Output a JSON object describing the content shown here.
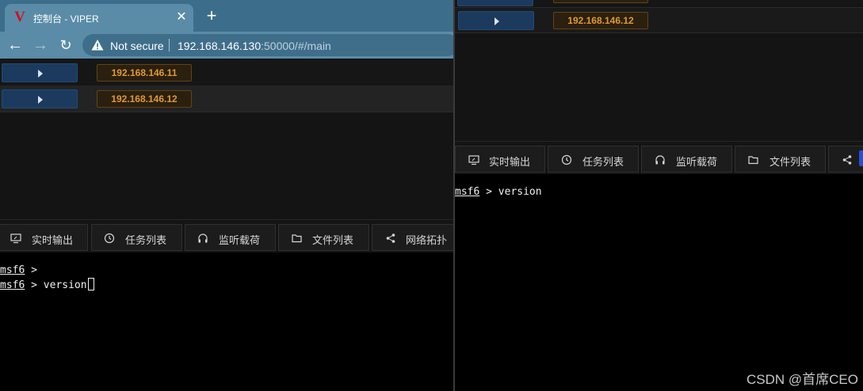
{
  "browser": {
    "tab": {
      "title": "控制台 - VIPER",
      "favicon": "V",
      "close_glyph": "✕"
    },
    "new_tab_glyph": "+",
    "nav": {
      "back_glyph": "←",
      "forward_glyph": "→",
      "reload_glyph": "↻"
    },
    "omnibox": {
      "security_label": "Not secure",
      "url_host": "192.168.146.130",
      "url_rest": ":50000/#/main"
    }
  },
  "sessions_left": [
    {
      "ip": "192.168.146.11"
    },
    {
      "ip": "192.168.146.12"
    }
  ],
  "sessions_right": [
    {
      "ip": ""
    },
    {
      "ip": "192.168.146.12"
    }
  ],
  "panel_tabs_left": [
    {
      "label": "实时输出",
      "icon": "monitor-icon"
    },
    {
      "label": "任务列表",
      "icon": "clock-icon"
    },
    {
      "label": "监听载荷",
      "icon": "headphones-icon"
    },
    {
      "label": "文件列表",
      "icon": "folder-icon"
    },
    {
      "label": "网络拓扑",
      "icon": "share-icon"
    }
  ],
  "panel_tabs_right": [
    {
      "label": "实时输出",
      "icon": "monitor-icon"
    },
    {
      "label": "任务列表",
      "icon": "clock-icon"
    },
    {
      "label": "监听载荷",
      "icon": "headphones-icon"
    },
    {
      "label": "文件列表",
      "icon": "folder-icon"
    },
    {
      "label": "",
      "icon": "share-icon"
    }
  ],
  "terminal_left": {
    "lines": [
      {
        "prompt": "msf6",
        "rest": " >"
      },
      {
        "prompt": "msf6",
        "rest": " > version"
      }
    ]
  },
  "terminal_right": {
    "lines": [
      {
        "prompt": "msf6",
        "rest": " > version"
      }
    ]
  },
  "watermark": "CSDN @首席CEO",
  "colors": {
    "tabstrip": "#3c6e8c",
    "toolbar": "#5a8ca8",
    "ip_tag_text": "#e09a2e",
    "expand_button": "#1c3a5e",
    "terminal_bg": "#000000",
    "favicon_red": "#d0101e"
  }
}
